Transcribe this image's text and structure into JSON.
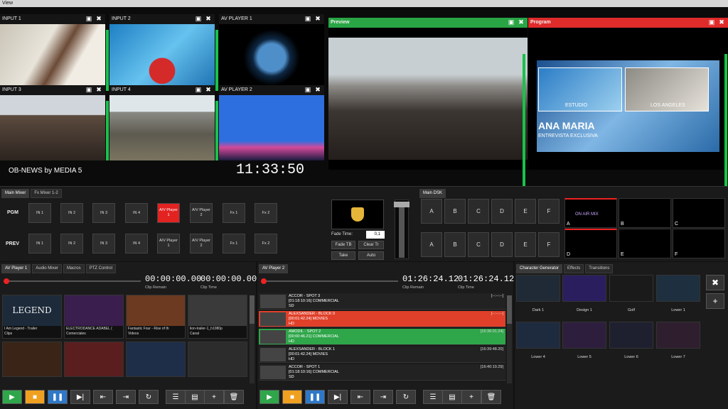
{
  "menu": {
    "view": "View"
  },
  "multiview": {
    "tiles": [
      {
        "label": "INPUT 1"
      },
      {
        "label": "INPUT 2"
      },
      {
        "label": "AV PLAYER 1"
      },
      {
        "label": "INPUT 3"
      },
      {
        "label": "INPUT 4"
      },
      {
        "label": "AV PLAYER 2"
      }
    ],
    "preview_label": "Preview",
    "program_label": "Program",
    "station_name": "OB-NEWS by MEDIA 5",
    "clock": "11:33:50",
    "program_lower_third": {
      "left": "ESTUDIO",
      "right": "LOS ANGELES",
      "name": "ANA MARIA",
      "subtitle": "ENTREVISTA EXCLUSIVA"
    }
  },
  "mixer": {
    "tabs": [
      "Main Mixer",
      "Fx Mixer 1-2"
    ],
    "pgm_label": "PGM",
    "prev_label": "PREV",
    "pgm_buttons": [
      "IN 1",
      "IN 2",
      "IN 3",
      "IN 4",
      "A/V Player 1",
      "A/V Player 2",
      "Fx 1",
      "Fx 2"
    ],
    "prev_buttons": [
      "IN 1",
      "IN 2",
      "IN 3",
      "IN 4",
      "A/V Player 1",
      "A/V Player 2",
      "Fx 1",
      "Fx 2"
    ],
    "fade_time_label": "Fade Time:",
    "fade_time_value": "0,1",
    "fade_tb": "Fade TB",
    "clear_tr": "Clear Tr",
    "take": "Take",
    "auto": "Auto"
  },
  "dsk": {
    "tab": "Main DSK",
    "row1": [
      "A",
      "B",
      "C",
      "D",
      "E",
      "F"
    ],
    "row2": [
      "A",
      "B",
      "C",
      "D",
      "E",
      "F"
    ],
    "thumbs": [
      {
        "letter": "A",
        "text": "ON AIR MIX"
      },
      {
        "letter": "B",
        "text": ""
      },
      {
        "letter": "C",
        "text": ""
      },
      {
        "letter": "D",
        "text": ""
      },
      {
        "letter": "E",
        "text": ""
      },
      {
        "letter": "F",
        "text": ""
      }
    ]
  },
  "player1": {
    "tabs": [
      "AV Player 1",
      "Audio Mixer",
      "Macros",
      "PTZ Control"
    ],
    "clip_remain": "00:00:00.00",
    "clip_time": "00:00:00.00",
    "clip_remain_label": "Clip Remain",
    "clip_time_label": "Clip Time",
    "clips": [
      {
        "title": "I Am Legend - Trailer",
        "group": "Clips",
        "art": "LEGEND"
      },
      {
        "title": "ELECTRODANCE ADABEL (",
        "group": "Comerciales",
        "art": ""
      },
      {
        "title": "Fantastic Four - Rise of th",
        "group": "Videos",
        "art": ""
      },
      {
        "title": "lion-trailer-1_h1080p",
        "group": "Canal",
        "art": ""
      }
    ]
  },
  "player2": {
    "tab": "AV Player 2",
    "clip_remain": "01:26:24.12",
    "clip_time": "01:26:24.12",
    "clip_remain_label": "Clip Remain",
    "clip_time_label": "Clip Time",
    "items": [
      {
        "title": "ACCOR - SPOT 3",
        "info": "[01:18:10:16]  COMMERCIAL",
        "fmt": "SD",
        "time": "[--:--:--]",
        "color": "#222222"
      },
      {
        "title": "ALEXSANDER - BLOCK 0",
        "info": "[00:01:42.24]  MOVIES",
        "fmt": "HD",
        "time": "[--:--:--]",
        "color": "#e0402a"
      },
      {
        "title": "AMODIL - SPOT 2",
        "info": "[00:00:46.21]  COMMERCIAL",
        "fmt": "HD",
        "time": "[16:36:01.24]",
        "color": "#2fa64a"
      },
      {
        "title": "ALEXSANDER - BLOCK 1",
        "info": "[00:01:42.24]  MOVIES",
        "fmt": "HD",
        "time": "[16:39:48.20]",
        "color": "#222222"
      },
      {
        "title": "ACCOR - SPOT 1",
        "info": "[01:18:10:16]  COMMERCIAL",
        "fmt": "SD",
        "time": "[16:40:19.29]",
        "color": "#222222"
      }
    ]
  },
  "cg": {
    "tabs": [
      "Character Generator",
      "Effects",
      "Transitions"
    ],
    "items": [
      "Dark 1",
      "Design 1",
      "Golf",
      "Lower 1",
      "Lower 4",
      "Lower 5",
      "Lower 6",
      "Lower 7"
    ]
  }
}
